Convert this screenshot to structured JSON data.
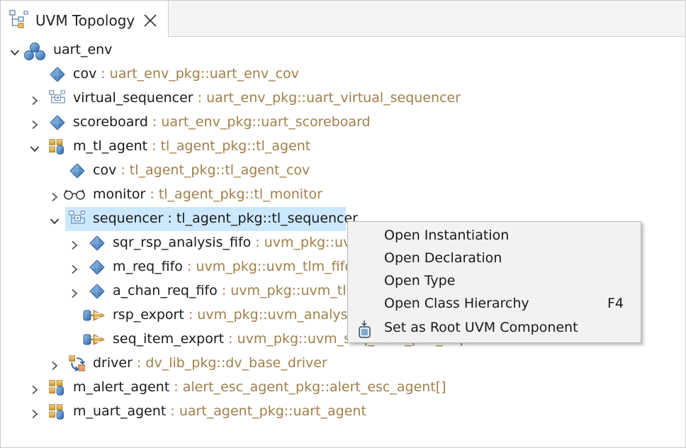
{
  "tab": {
    "title": "UVM Topology",
    "icon": "topology-icon",
    "close_icon": "close-icon"
  },
  "tree": [
    {
      "id": "uart_env",
      "name": "uart_env",
      "type": "",
      "icon": "environment-icon",
      "expanded": true
    },
    {
      "id": "cov",
      "name": "cov",
      "type": " : uart_env_pkg::uart_env_cov",
      "icon": "component-icon"
    },
    {
      "id": "virtual_sequencer",
      "name": "virtual_sequencer",
      "type": " : uart_env_pkg::uart_virtual_sequencer",
      "icon": "sequencer-icon",
      "expanded": false
    },
    {
      "id": "scoreboard",
      "name": "scoreboard",
      "type": " : uart_env_pkg::uart_scoreboard",
      "icon": "component-icon",
      "expanded": false
    },
    {
      "id": "m_tl_agent",
      "name": "m_tl_agent",
      "type": " : tl_agent_pkg::tl_agent",
      "icon": "agent-icon",
      "expanded": true
    },
    {
      "id": "tl_cov",
      "name": "cov",
      "type": " : tl_agent_pkg::tl_agent_cov",
      "icon": "component-icon"
    },
    {
      "id": "monitor",
      "name": "monitor",
      "type": " : tl_agent_pkg::tl_monitor",
      "icon": "monitor-icon",
      "expanded": false
    },
    {
      "id": "sequencer",
      "name": "sequencer",
      "type": " : tl_agent_pkg::tl_sequencer",
      "icon": "sequencer-icon",
      "expanded": true,
      "selected": true
    },
    {
      "id": "sqr_rsp_analysis_fifo",
      "name": "sqr_rsp_analysis_fifo",
      "type": " : uvm_pkg::uvm_tlm_analysis_fifo",
      "icon": "component-icon",
      "expanded": false
    },
    {
      "id": "m_req_fifo",
      "name": "m_req_fifo",
      "type": " : uvm_pkg::uvm_tlm_fifo",
      "icon": "component-icon",
      "expanded": false
    },
    {
      "id": "a_chan_req_fifo",
      "name": "a_chan_req_fifo",
      "type": " : uvm_pkg::uvm_tlm_fifo",
      "icon": "component-icon",
      "expanded": false
    },
    {
      "id": "rsp_export",
      "name": "rsp_export",
      "type": " : uvm_pkg::uvm_analysis_export",
      "icon": "export-icon"
    },
    {
      "id": "seq_item_export",
      "name": "seq_item_export",
      "type": " : uvm_pkg::uvm_seq_item_pull_imp",
      "icon": "export-icon"
    },
    {
      "id": "driver",
      "name": "driver",
      "type": " : dv_lib_pkg::dv_base_driver",
      "icon": "driver-icon",
      "expanded": false
    },
    {
      "id": "m_alert_agent",
      "name": "m_alert_agent",
      "type": " : alert_esc_agent_pkg::alert_esc_agent[]",
      "icon": "agent-icon",
      "expanded": false
    },
    {
      "id": "m_uart_agent",
      "name": "m_uart_agent",
      "type": " : uart_agent_pkg::uart_agent",
      "icon": "agent-icon",
      "expanded": false
    }
  ],
  "context_menu": {
    "items": [
      {
        "label": "Open Instantiation",
        "accel": ""
      },
      {
        "label": "Open Declaration",
        "accel": ""
      },
      {
        "label": "Open Type",
        "accel": ""
      },
      {
        "label": "Open Class Hierarchy",
        "accel": "F4"
      },
      {
        "label": "Set as Root UVM Component",
        "accel": "",
        "icon": "set-root-icon"
      }
    ]
  },
  "colors": {
    "type_text": "#a0804a",
    "selection": "#cce8ff",
    "icon_blue": "#3f7fbf",
    "menu_bg": "#f2f2f2"
  }
}
